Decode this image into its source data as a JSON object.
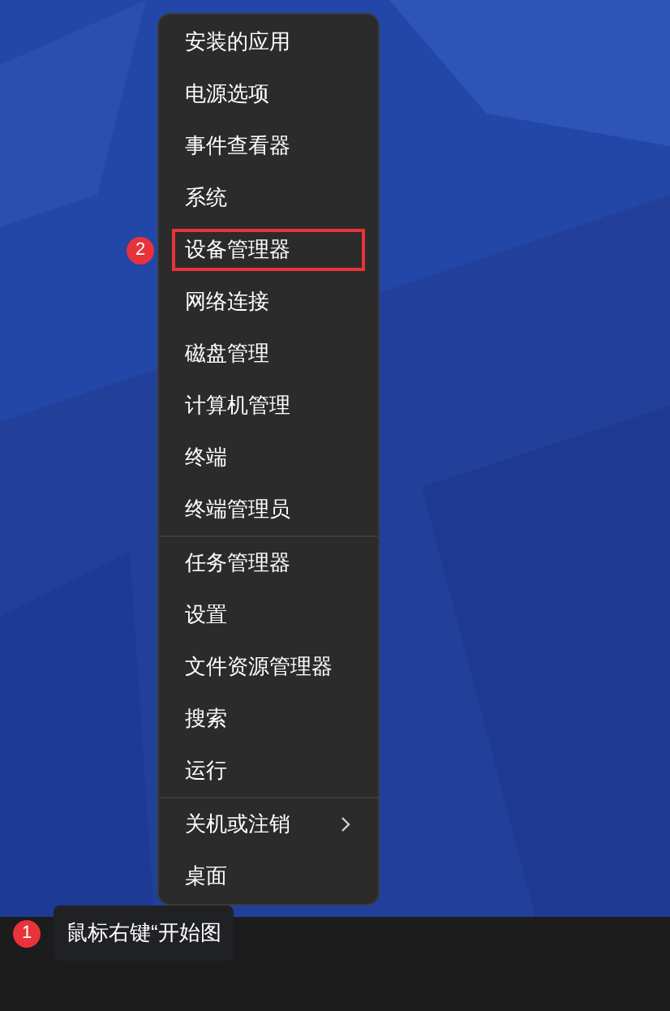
{
  "context_menu": {
    "groups": [
      [
        {
          "label": "安装的应用",
          "submenu": false
        },
        {
          "label": "电源选项",
          "submenu": false
        },
        {
          "label": "事件查看器",
          "submenu": false
        },
        {
          "label": "系统",
          "submenu": false
        },
        {
          "label": "设备管理器",
          "submenu": false,
          "callout": "2"
        },
        {
          "label": "网络连接",
          "submenu": false
        },
        {
          "label": "磁盘管理",
          "submenu": false
        },
        {
          "label": "计算机管理",
          "submenu": false
        },
        {
          "label": "终端",
          "submenu": false
        },
        {
          "label": "终端管理员",
          "submenu": false
        }
      ],
      [
        {
          "label": "任务管理器",
          "submenu": false
        },
        {
          "label": "设置",
          "submenu": false
        },
        {
          "label": "文件资源管理器",
          "submenu": false
        },
        {
          "label": "搜索",
          "submenu": false
        },
        {
          "label": "运行",
          "submenu": false
        }
      ],
      [
        {
          "label": "关机或注销",
          "submenu": true
        },
        {
          "label": "桌面",
          "submenu": false
        }
      ]
    ]
  },
  "tooltip": {
    "badge": "1",
    "text": "鼠标右键“开始图"
  }
}
